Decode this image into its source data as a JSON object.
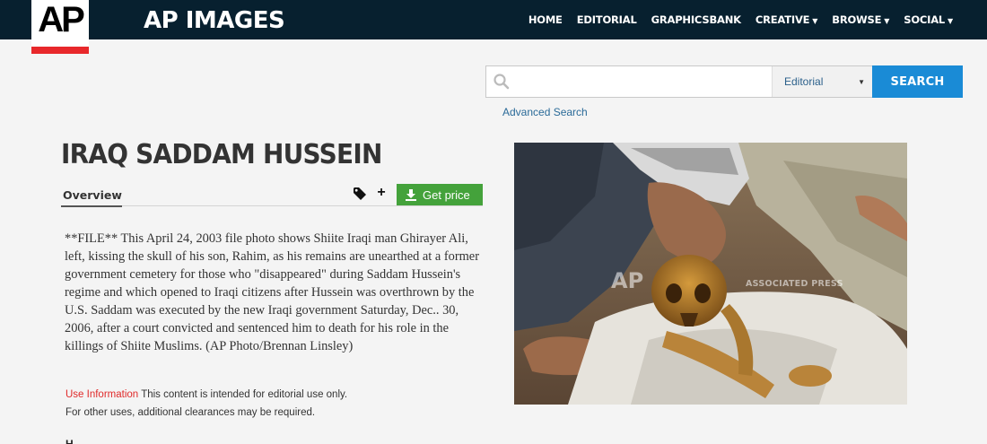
{
  "header": {
    "logo_text": "AP",
    "brand": "AP IMAGES",
    "nav": [
      {
        "label": "HOME",
        "dropdown": false
      },
      {
        "label": "EDITORIAL",
        "dropdown": false
      },
      {
        "label": "GRAPHICSBANK",
        "dropdown": false
      },
      {
        "label": "CREATIVE",
        "dropdown": true
      },
      {
        "label": "BROWSE",
        "dropdown": true
      },
      {
        "label": "SOCIAL",
        "dropdown": true
      }
    ]
  },
  "search": {
    "value": "",
    "placeholder": "",
    "category": "Editorial",
    "button_label": "SEARCH",
    "advanced_label": "Advanced Search"
  },
  "detail": {
    "title": "IRAQ SADDAM HUSSEIN",
    "tab_overview": "Overview",
    "get_price_label": "Get price",
    "caption": "**FILE** This April 24, 2003 file photo shows Shiite Iraqi man Ghirayer Ali, left, kissing the skull of his son, Rahim, as his remains are unearthed at a former government cemetery for those who \"disappeared\" during Saddam Hussein's regime and which opened to Iraqi citizens after Hussein was overthrown by the U.S. Saddam was executed by the new Iraqi government Saturday, Dec.. 30, 2006, after a court convicted and sentenced him to death for his role in the killings of Shiite Muslims. (AP Photo/Brennan Linsley)",
    "use_info_label": "Use Information",
    "use_info_text": "This content is intended for editorial use only.",
    "use_info_text2": "For other uses, additional clearances may be required.",
    "cut_off_text": "H"
  },
  "photo": {
    "watermark_logo": "AP",
    "watermark_text": "ASSOCIATED PRESS"
  },
  "colors": {
    "header_bg": "#07202f",
    "accent_blue": "#1a8bd6",
    "price_green": "#44a23b",
    "logo_red": "#e8282b",
    "use_info_red": "#e02a2a"
  }
}
